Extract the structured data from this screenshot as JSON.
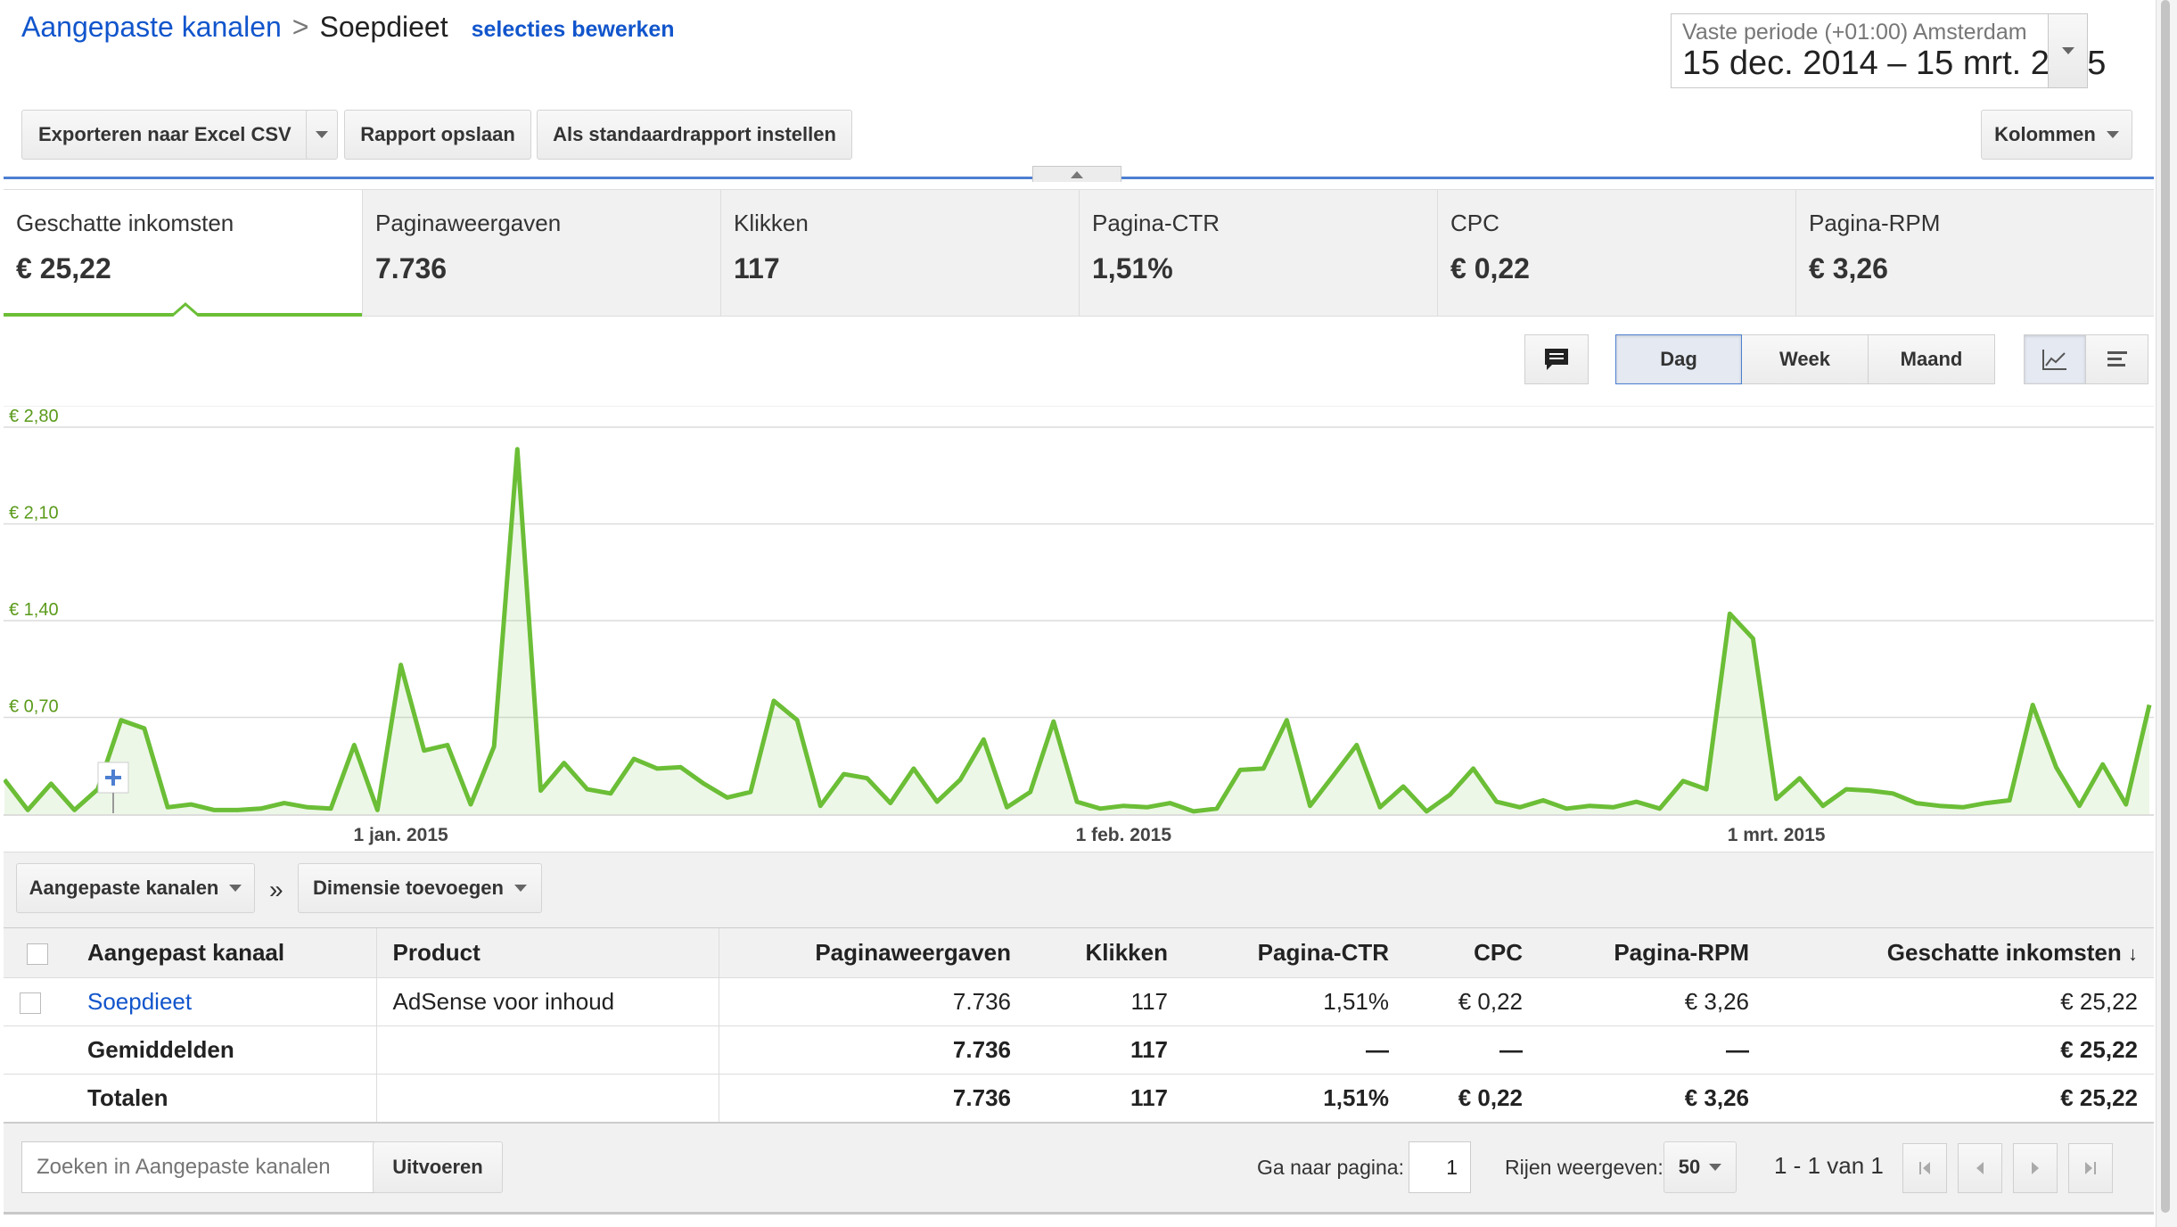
{
  "breadcrumb": {
    "parent": "Aangepaste kanalen",
    "separator": ">",
    "current": "Soepdieet",
    "edit_link": "selecties bewerken"
  },
  "date_range": {
    "label": "Vaste periode (+01:00) Amsterdam",
    "range": "15 dec. 2014 – 15 mrt. 2015"
  },
  "toolbar": {
    "export": "Exporteren naar Excel CSV",
    "save": "Rapport opslaan",
    "set_default": "Als standaardrapport instellen",
    "columns": "Kolommen"
  },
  "metrics": [
    {
      "label": "Geschatte inkomsten",
      "value": "€ 25,22"
    },
    {
      "label": "Paginaweergaven",
      "value": "7.736"
    },
    {
      "label": "Klikken",
      "value": "117"
    },
    {
      "label": "Pagina-CTR",
      "value": "1,51%"
    },
    {
      "label": "CPC",
      "value": "€ 0,22"
    },
    {
      "label": "Pagina-RPM",
      "value": "€ 3,26"
    }
  ],
  "granularity": {
    "day": "Dag",
    "week": "Week",
    "month": "Maand",
    "selected": "Dag"
  },
  "icons": {
    "comment": "comment-icon",
    "line_chart": "line-chart-icon",
    "bar_chart": "bar-chart-icon"
  },
  "colors": {
    "series": "#6bbe36",
    "link": "#1155cc",
    "accent_line": "#4d7fd1"
  },
  "chart_data": {
    "type": "area",
    "ylim": [
      0,
      2.8
    ],
    "y_ticks": [
      "€ 2,80",
      "€ 2,10",
      "€ 1,40",
      "€ 0,70"
    ],
    "x_ticks": [
      {
        "label": "1 jan. 2015",
        "index": 17
      },
      {
        "label": "1 feb. 2015",
        "index": 48
      },
      {
        "label": "1 mrt. 2015",
        "index": 76
      }
    ],
    "grid": true,
    "series": [
      {
        "start": "15 dec. 2014",
        "values": [
          0.25,
          0.03,
          0.22,
          0.03,
          0.18,
          0.68,
          0.62,
          0.05,
          0.07,
          0.03,
          0.03,
          0.04,
          0.08,
          0.05,
          0.04,
          0.5,
          0.03,
          1.08,
          0.46,
          0.5,
          0.07,
          0.49,
          2.64,
          0.17,
          0.37,
          0.18,
          0.15,
          0.4,
          0.33,
          0.34,
          0.22,
          0.12,
          0.16,
          0.82,
          0.68,
          0.06,
          0.29,
          0.26,
          0.08,
          0.33,
          0.09,
          0.25,
          0.54,
          0.05,
          0.16,
          0.67,
          0.09,
          0.04,
          0.06,
          0.05,
          0.08,
          0.02,
          0.04,
          0.32,
          0.33,
          0.68,
          0.06,
          0.28,
          0.5,
          0.05,
          0.2,
          0.02,
          0.14,
          0.33,
          0.09,
          0.05,
          0.1,
          0.04,
          0.06,
          0.05,
          0.09,
          0.04,
          0.24,
          0.18,
          1.45,
          1.27,
          0.11,
          0.26,
          0.06,
          0.18,
          0.17,
          0.15,
          0.08,
          0.06,
          0.05,
          0.08,
          0.1,
          0.79,
          0.34,
          0.06,
          0.36,
          0.07,
          0.79
        ]
      }
    ]
  },
  "dimensions": {
    "primary": "Aangepaste kanalen",
    "separator": "»",
    "add": "Dimensie toevoegen"
  },
  "table": {
    "headers": [
      "Aangepast kanaal",
      "Product",
      "Paginaweergaven",
      "Klikken",
      "Pagina-CTR",
      "CPC",
      "Pagina-RPM",
      "Geschatte inkomsten"
    ],
    "sort_indicator": "↓",
    "rows": [
      {
        "name": "Soepdieet",
        "product": "AdSense voor inhoud",
        "views": "7.736",
        "clicks": "117",
        "ctr": "1,51%",
        "cpc": "€ 0,22",
        "rpm": "€ 3,26",
        "income": "€ 25,22"
      }
    ],
    "averages": {
      "name": "Gemiddelden",
      "views": "7.736",
      "clicks": "117",
      "ctr": "—",
      "cpc": "—",
      "rpm": "—",
      "income": "€ 25,22"
    },
    "totals": {
      "name": "Totalen",
      "views": "7.736",
      "clicks": "117",
      "ctr": "1,51%",
      "cpc": "€ 0,22",
      "rpm": "€ 3,26",
      "income": "€ 25,22"
    }
  },
  "footer": {
    "search_placeholder": "Zoeken in Aangepaste kanalen",
    "run": "Uitvoeren",
    "goto_label": "Ga naar pagina:",
    "goto_value": "1",
    "rows_label": "Rijen weergeven:",
    "rows_value": "50",
    "range": "1 - 1 van 1"
  }
}
